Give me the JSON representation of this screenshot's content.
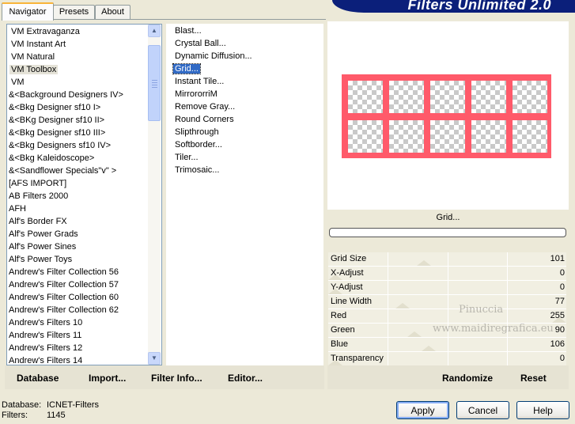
{
  "tabs": [
    "Navigator",
    "Presets",
    "About"
  ],
  "banner_title": "Filters Unlimited 2.0",
  "categories": [
    "VM Extravaganza",
    "VM Instant Art",
    "VM Natural",
    "VM Toolbox",
    "VM",
    "&<Background Designers IV>",
    "&<Bkg Designer sf10 I>",
    "&<BKg Designer sf10 II>",
    "&<Bkg Designer sf10 III>",
    "&<Bkg Designers sf10 IV>",
    "&<Bkg Kaleidoscope>",
    "&<Sandflower Specials\"v\" >",
    "[AFS IMPORT]",
    "AB Filters 2000",
    "AFH",
    "Alf's Border FX",
    "Alf's Power Grads",
    "Alf's Power Sines",
    "Alf's Power Toys",
    "Andrew's Filter Collection 56",
    "Andrew's Filter Collection 57",
    "Andrew's Filter Collection 60",
    "Andrew's Filter Collection 62",
    "Andrew's Filters 10",
    "Andrew's Filters 11",
    "Andrew's Filters 12",
    "Andrew's Filters 14"
  ],
  "selected_category": "VM Toolbox",
  "filters": [
    "Blast...",
    "Crystal Ball...",
    "Dynamic Diffusion...",
    "Grid...",
    "Instant Tile...",
    "MirrororriM",
    "Remove Gray...",
    "Round Corners",
    "Slipthrough",
    "Softborder...",
    "Tiler...",
    "Trimosaic..."
  ],
  "selected_filter": "Grid...",
  "preview_title": "Grid...",
  "params": [
    {
      "label": "Grid Size",
      "value": "101",
      "level": 101
    },
    {
      "label": "X-Adjust",
      "value": "0",
      "level": 0
    },
    {
      "label": "Y-Adjust",
      "value": "0",
      "level": 0
    },
    {
      "label": "Line Width",
      "value": "77",
      "level": 77
    },
    {
      "label": "Red",
      "value": "255",
      "level": 255
    },
    {
      "label": "Green",
      "value": "90",
      "level": 90
    },
    {
      "label": "Blue",
      "value": "106",
      "level": 106
    },
    {
      "label": "Transparency",
      "value": "0",
      "level": 0
    }
  ],
  "watermark": [
    "Pinuccia",
    "www.maidiregrafica.eu"
  ],
  "bottom_left_buttons": [
    "Database",
    "Import...",
    "Filter Info...",
    "Editor..."
  ],
  "right_buttons": [
    "Randomize",
    "Reset"
  ],
  "status": {
    "database_label": "Database:",
    "database_value": "ICNET-Filters",
    "filters_label": "Filters:",
    "filters_value": "1145"
  },
  "dialog_buttons": {
    "apply": "Apply",
    "cancel": "Cancel",
    "help": "Help"
  },
  "grid_color": "#ff5a6a"
}
